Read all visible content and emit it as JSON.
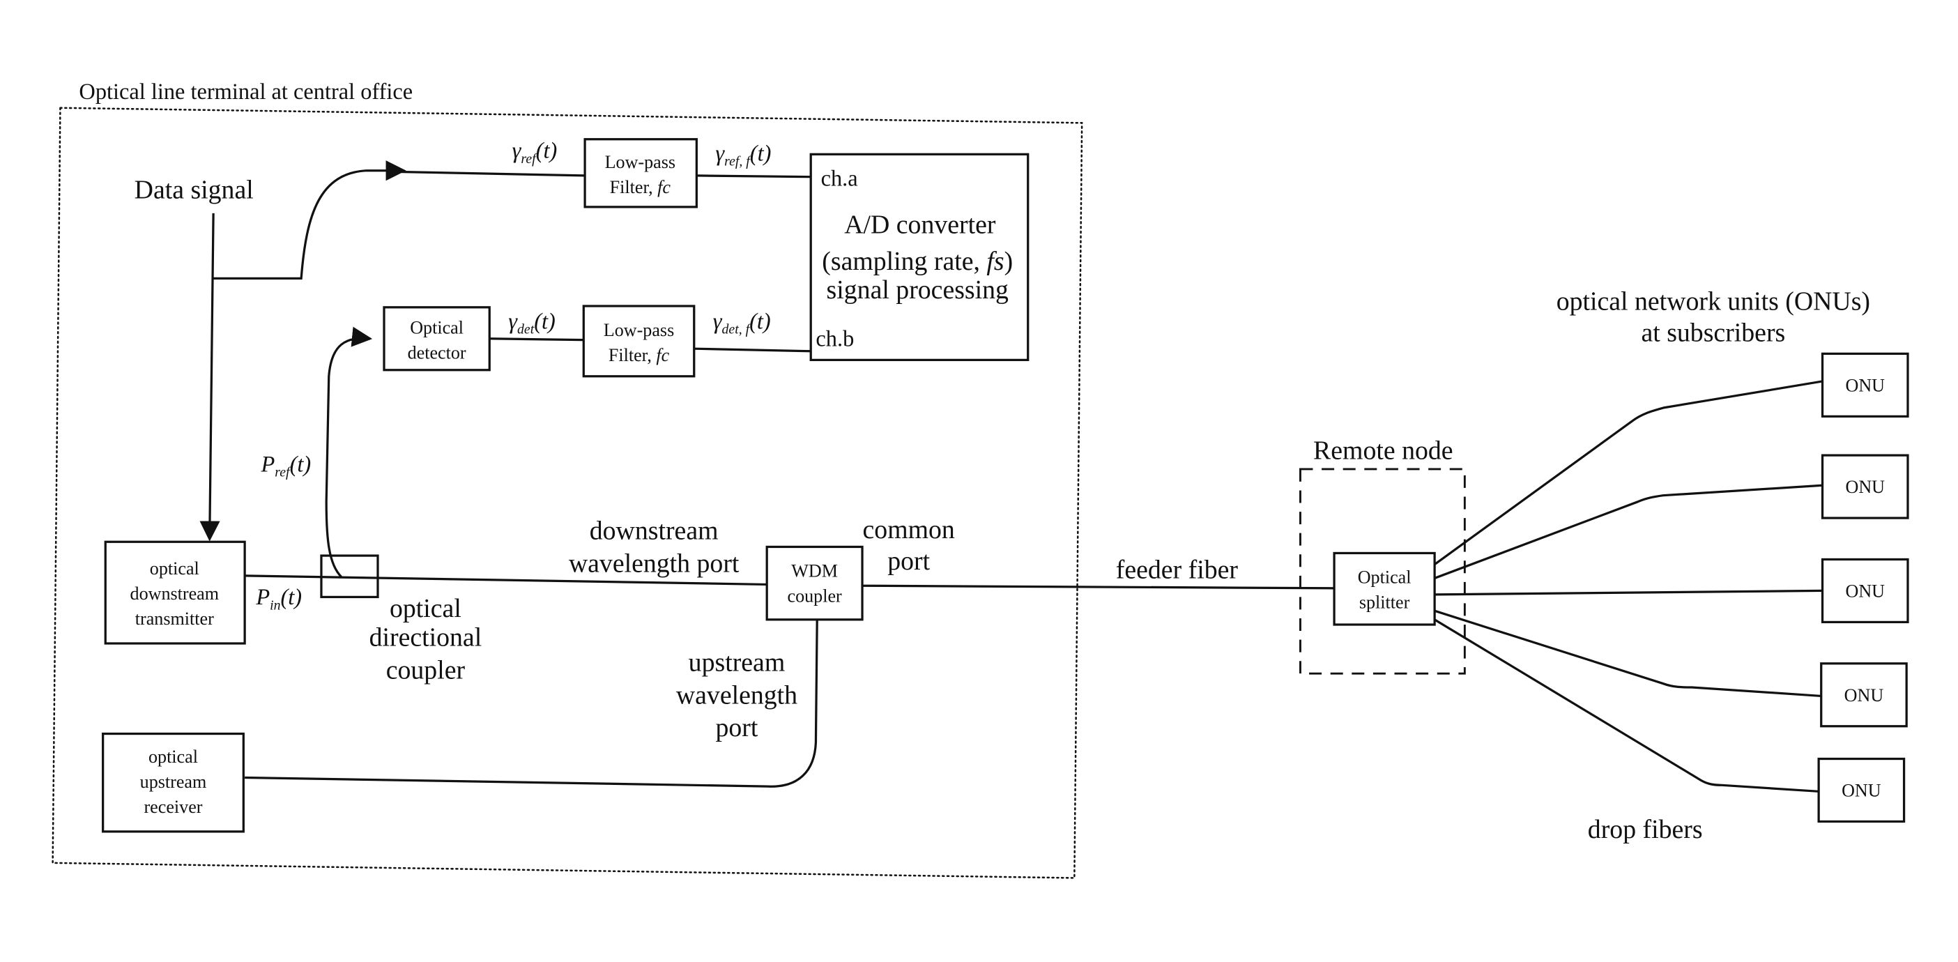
{
  "olt": {
    "title": "Optical line terminal at central office",
    "data_signal": "Data signal",
    "lpf_ref": {
      "line1": "Low-pass",
      "line2": "Filter, ",
      "fc": "fc"
    },
    "lpf_det": {
      "line1": "Low-pass",
      "line2": "Filter, ",
      "fc": "fc"
    },
    "adc": {
      "ch_a": "ch.a",
      "ch_b": "ch.b",
      "line1": "A/D  converter",
      "line2a": "(sampling rate, ",
      "line2b": "fs",
      "line2c": ")",
      "line3": "signal processing"
    },
    "detector": {
      "line1": "Optical",
      "line2": "detector"
    },
    "signals": {
      "y_ref": {
        "sym": "γ",
        "sub": "ref",
        "arg": "(t)"
      },
      "y_ref_f": {
        "sym": "γ",
        "sub": "ref, f",
        "arg": "(t)"
      },
      "y_det": {
        "sym": "γ",
        "sub": "det",
        "arg": "(t)"
      },
      "y_det_f": {
        "sym": "γ",
        "sub": "det, f",
        "arg": "(t)"
      },
      "p_ref": {
        "sym": "P",
        "sub": "ref",
        "arg": "(t)"
      },
      "p_in": {
        "sym": "P",
        "sub": "in",
        "arg": "(t)"
      }
    },
    "transmitter": {
      "line1": "optical",
      "line2": "downstream",
      "line3": "transmitter"
    },
    "receiver": {
      "line1": "optical",
      "line2": "upstream",
      "line3": "receiver"
    },
    "coupler_label": {
      "line1": "optical",
      "line2": "directional",
      "line3": "coupler"
    },
    "downstream_port": {
      "line1": "downstream",
      "line2": "wavelength port"
    },
    "upstream_port": {
      "line1": "upstream",
      "line2": "wavelength",
      "line3": "port"
    },
    "wdm": {
      "line1": "WDM",
      "line2": "coupler"
    },
    "common_port": {
      "line1": "common",
      "line2": "port"
    }
  },
  "feeder_fiber": "feeder fiber",
  "remote_node": {
    "title": "Remote node",
    "splitter": {
      "line1": "Optical",
      "line2": "splitter"
    }
  },
  "onus": {
    "title_line1": "optical network units (ONUs)",
    "title_line2": "at subscribers",
    "items": [
      "ONU",
      "ONU",
      "ONU",
      "ONU",
      "ONU"
    ]
  },
  "drop_fibers": "drop fibers"
}
